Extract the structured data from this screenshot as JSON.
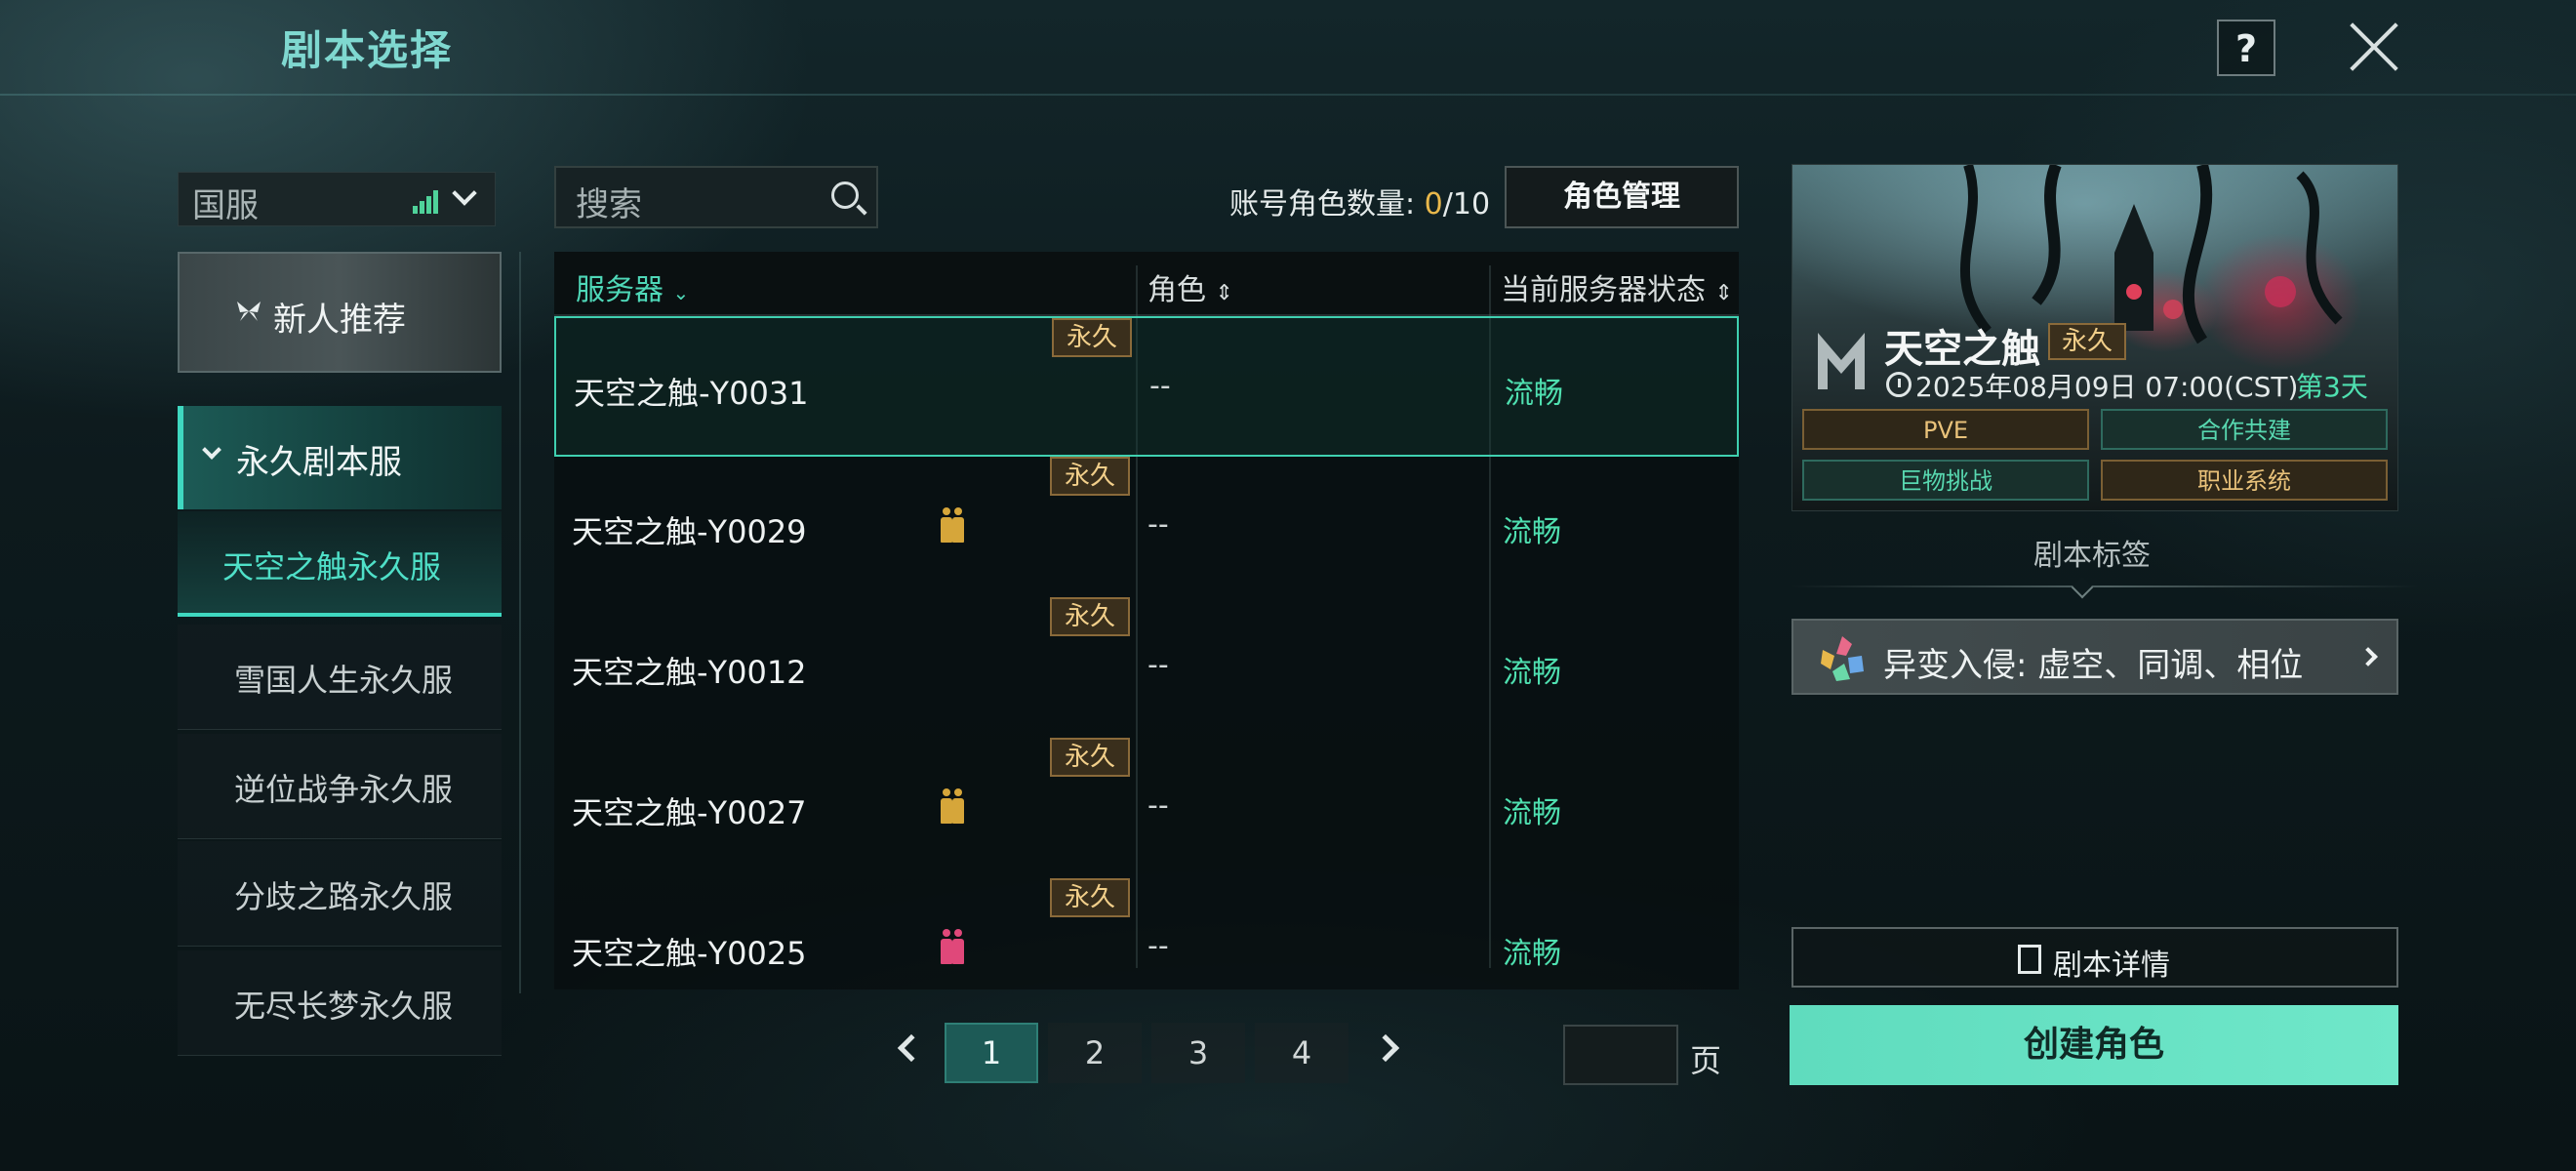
{
  "header": {
    "title": "剧本选择",
    "help_label": "?"
  },
  "region": {
    "value": "国服"
  },
  "newbie": {
    "label": "新人推荐"
  },
  "category": {
    "label": "永久剧本服",
    "items": [
      {
        "label": "天空之触永久服"
      },
      {
        "label": "雪国人生永久服"
      },
      {
        "label": "逆位战争永久服"
      },
      {
        "label": "分歧之路永久服"
      },
      {
        "label": "无尽长梦永久服"
      }
    ]
  },
  "search": {
    "placeholder": "搜索"
  },
  "account": {
    "prefix": "账号角色数量: ",
    "current": "0",
    "max": "/10",
    "manage_label": "角色管理"
  },
  "table": {
    "headers": {
      "server": "服务器",
      "role": "角色",
      "status": "当前服务器状态"
    },
    "rows": [
      {
        "server": "天空之触-Y0031",
        "tag": "永久",
        "role": "--",
        "status": "流畅",
        "people_color": ""
      },
      {
        "server": "天空之触-Y0029",
        "tag": "永久",
        "role": "--",
        "status": "流畅",
        "people_color": "#d6a63a"
      },
      {
        "server": "天空之触-Y0012",
        "tag": "永久",
        "role": "--",
        "status": "流畅",
        "people_color": ""
      },
      {
        "server": "天空之触-Y0027",
        "tag": "永久",
        "role": "--",
        "status": "流畅",
        "people_color": "#d6a63a"
      },
      {
        "server": "天空之触-Y0025",
        "tag": "永久",
        "role": "--",
        "status": "流畅",
        "people_color": "#e0487a"
      }
    ]
  },
  "pagination": {
    "pages": [
      "1",
      "2",
      "3",
      "4"
    ],
    "current": "1",
    "unit": "页"
  },
  "detail": {
    "title": "天空之触",
    "tag": "永久",
    "date": "2025年08月09日 07:00(CST)",
    "day": "第3天",
    "features": [
      {
        "label": "PVE",
        "style": "gold"
      },
      {
        "label": "合作共建",
        "style": "teal"
      },
      {
        "label": "巨物挑战",
        "style": "teal"
      },
      {
        "label": "职业系统",
        "style": "gold"
      }
    ],
    "tags_section": "剧本标签",
    "tag_entry": "异变入侵: 虚空、同调、相位",
    "details_label": "剧本详情",
    "create_label": "创建角色"
  }
}
